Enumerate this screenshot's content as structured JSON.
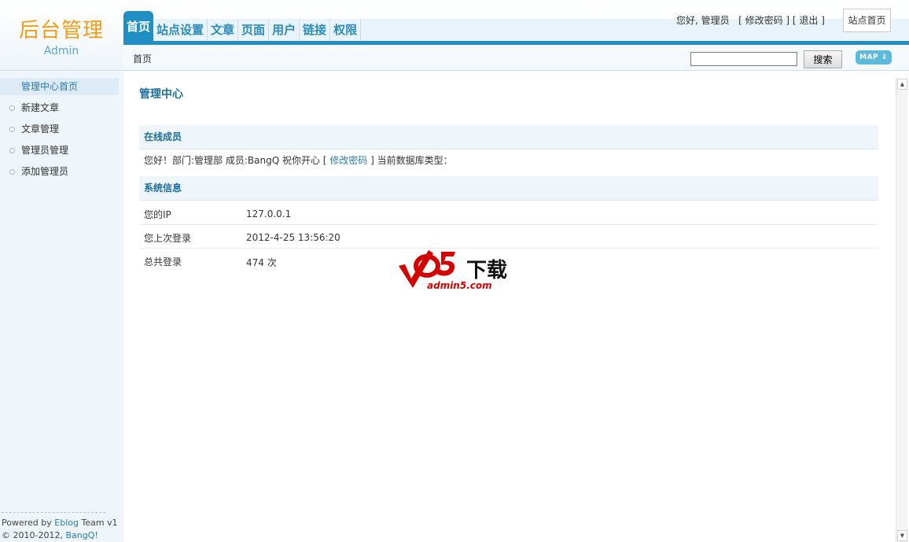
{
  "logo": {
    "title": "后台管理",
    "subtitle": "Admin"
  },
  "nav": {
    "items": [
      {
        "label": "首页",
        "active": true
      },
      {
        "label": "站点设置"
      },
      {
        "label": "文章"
      },
      {
        "label": "页面"
      },
      {
        "label": "用户"
      },
      {
        "label": "链接"
      },
      {
        "label": "权限"
      }
    ]
  },
  "user": {
    "greeting": "您好, 管理员",
    "change_password": "修改密码",
    "logout": "退出",
    "site_home": "站点首页"
  },
  "subbar": {
    "breadcrumb": "首页",
    "search_value": "",
    "search_button": "搜索",
    "map_label": "MAP"
  },
  "sidebar": {
    "items": [
      {
        "label": "管理中心首页",
        "active": true
      },
      {
        "label": "新建文章"
      },
      {
        "label": "文章管理"
      },
      {
        "label": "管理员管理"
      },
      {
        "label": "添加管理员"
      }
    ],
    "footer": {
      "powered_prefix": "Powered by ",
      "powered_link": "Eblog",
      "powered_suffix": " Team v1",
      "copyright_prefix": "© 2010-2012, ",
      "copyright_link": "BangQ!"
    }
  },
  "main": {
    "title": "管理中心",
    "online": {
      "header": "在线成员",
      "text_before": "您好！部门:管理部  成员:BangQ 祝你开心 [ ",
      "link": "修改密码",
      "text_after": " ] 当前数据库类型："
    },
    "sysinfo": {
      "header": "系统信息",
      "rows": [
        {
          "key": "您的IP",
          "value": "127.0.0.1"
        },
        {
          "key": "您上次登录",
          "value": "2012-4-25 13:56:20"
        },
        {
          "key": "总共登录",
          "value": "474 次"
        }
      ]
    }
  },
  "watermark": {
    "brand": "下载",
    "url": "admin5.com"
  }
}
